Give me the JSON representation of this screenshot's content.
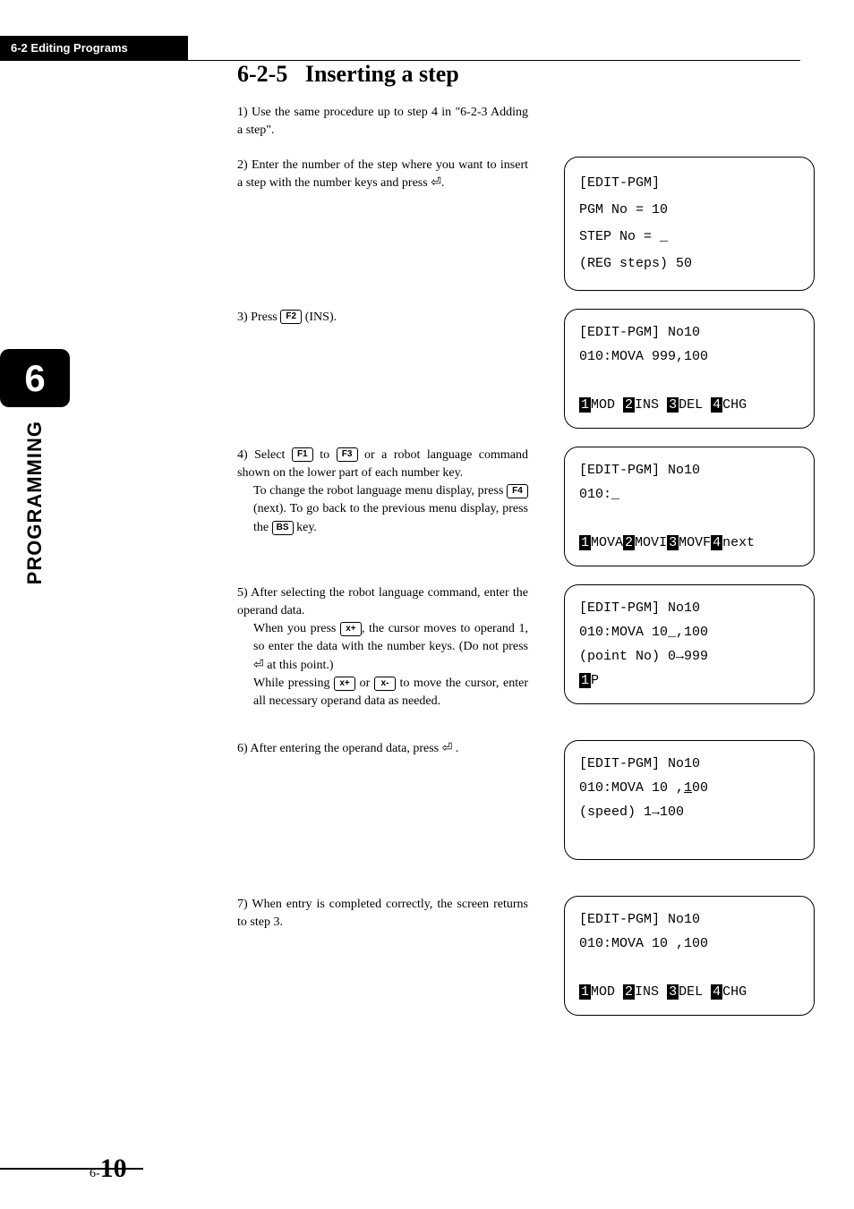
{
  "header": {
    "breadcrumb": "6-2 Editing Programs"
  },
  "side": {
    "chapter": "6",
    "label": "PROGRAMMING"
  },
  "section": {
    "number": "6-2-5",
    "title": "Inserting a step"
  },
  "keys": {
    "f1": "F1",
    "f2": "F2",
    "f3": "F3",
    "f4": "F4",
    "bs": "BS",
    "xplus": "x+",
    "xminus": "x-"
  },
  "steps": {
    "s1": {
      "num": "1)",
      "text": "Use the same procedure up to step 4 in \"6-2-3 Adding a step\"."
    },
    "s2": {
      "num": "2)",
      "text": "Enter the number of the step where you want to insert a step with the number keys and press",
      "tail": "."
    },
    "s3": {
      "num": "3)",
      "prefix": "Press ",
      "suffix": " (INS)."
    },
    "s4": {
      "num": "4)",
      "p1a": "Select ",
      "p1b": " to ",
      "p1c": " or a robot language command shown on the lower part of each number key.",
      "p2a": "To change the robot language menu display, press ",
      "p2b": " (next). To go back to the previous menu display, press the ",
      "p2c": " key."
    },
    "s5": {
      "num": "5)",
      "lead": "After selecting the robot language command, enter the operand data.",
      "p1a": "When you press ",
      "p1b": ", the cursor moves to operand 1, so enter the data with the number keys. (Do not press ",
      "enterGlyph": "⏎",
      "p1c": " at this point.)",
      "p2a": "While pressing ",
      "p2b": " or ",
      "p2c": " to move the cursor, enter all necessary operand data as needed."
    },
    "s6": {
      "num": "6)",
      "text": "After entering the operand data, press ",
      "enterGlyph": "⏎",
      "tail": " ."
    },
    "s7": {
      "num": "7)",
      "text": "When entry is completed correctly, the screen returns to step 3."
    }
  },
  "screens": {
    "a": {
      "l1": "[EDIT-PGM]",
      "l2": "PGM  No = 10",
      "l3": "STEP No = _",
      "l4": "(REG steps) 50"
    },
    "b": {
      "l1": "[EDIT-PGM]      No10",
      "l2": "010:MOVA 999,100",
      "menu": {
        "m1": "1",
        "t1": "MOD ",
        "m2": "2",
        "t2": "INS ",
        "m3": "3",
        "t3": "DEL ",
        "m4": "4",
        "t4": "CHG"
      }
    },
    "c": {
      "l1": "[EDIT-PGM]      No10",
      "l2": "010:_",
      "menu": {
        "m1": "1",
        "t1": "MOVA",
        "m2": "2",
        "t2": "MOVI",
        "m3": "3",
        "t3": "MOVF",
        "m4": "4",
        "t4": "next"
      }
    },
    "d": {
      "l1": "[EDIT-PGM]      No10",
      "l2": "010:MOVA 10_,100",
      "l3": "(point No) 0→999",
      "menu": {
        "m1": "1",
        "t1": "P"
      }
    },
    "e": {
      "l1": "[EDIT-PGM]      No10",
      "l2a": "010:MOVA 10 ,",
      "l2b": "1",
      "l2c": "00",
      "l3": "(speed) 1→100"
    },
    "f": {
      "l1": "[EDIT-PGM]      No10",
      "l2": "010:MOVA 10 ,100",
      "menu": {
        "m1": "1",
        "t1": "MOD ",
        "m2": "2",
        "t2": "INS ",
        "m3": "3",
        "t3": "DEL ",
        "m4": "4",
        "t4": "CHG"
      }
    }
  },
  "footer": {
    "prefix": "6-",
    "num": "10"
  }
}
